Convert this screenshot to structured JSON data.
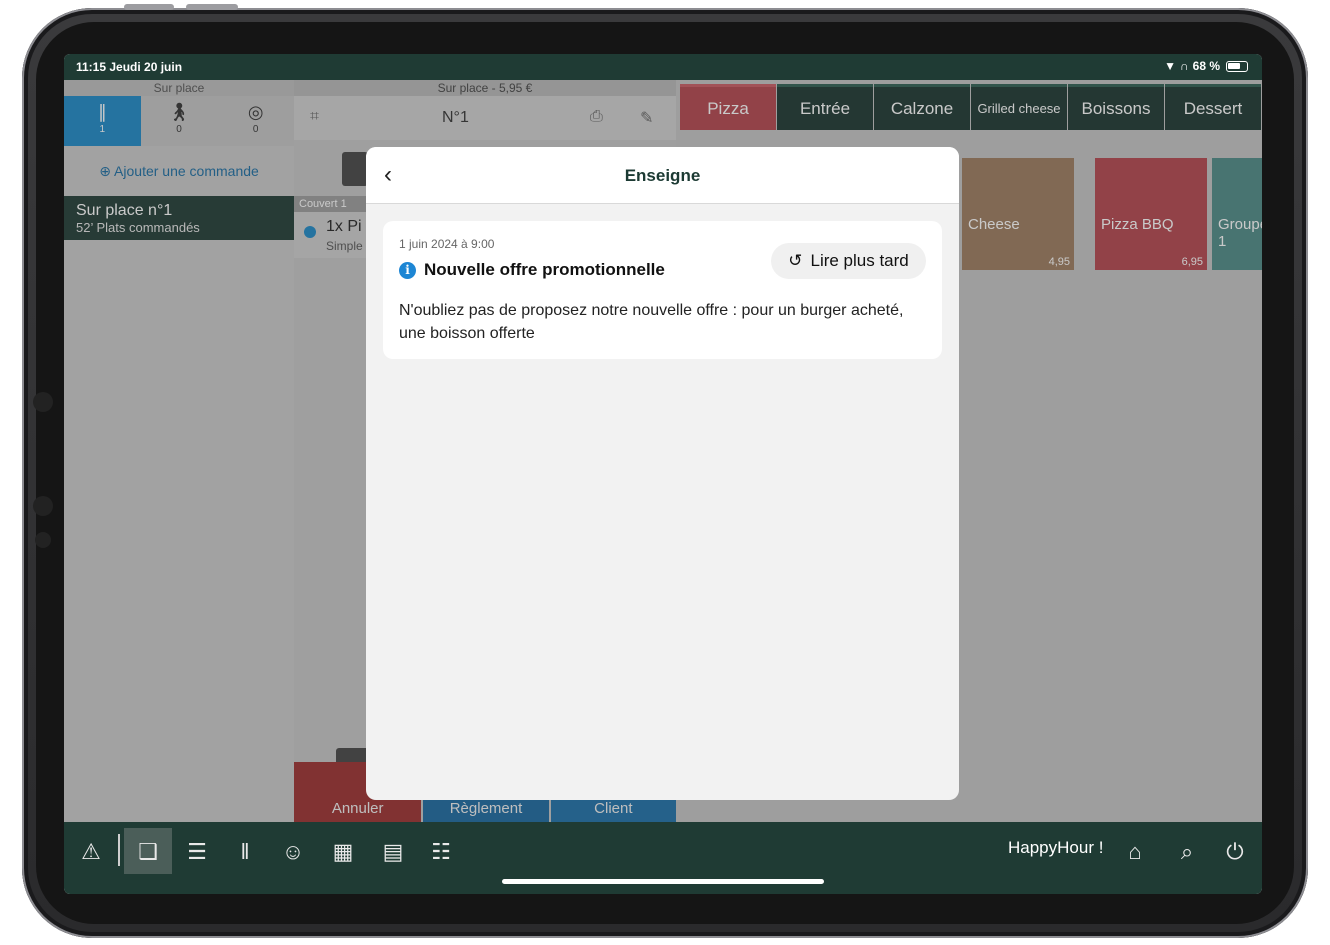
{
  "status_bar": {
    "time_date": "11:15  Jeudi 20 juin",
    "battery": "68 %"
  },
  "left_panel": {
    "header": "Sur place",
    "modes": [
      {
        "icon": "fork-knife-icon",
        "count": "1"
      },
      {
        "icon": "walking-person-icon",
        "count": "0"
      },
      {
        "icon": "location-pin-icon",
        "count": "0"
      }
    ],
    "add_order": "Ajouter une commande",
    "order": {
      "title": "Sur place n°1",
      "subtitle": "52’ Plats commandés"
    }
  },
  "middle_panel": {
    "header": "Sur place - 5,95 €",
    "number": "N°1",
    "cover_label": "Couvert 1",
    "item_name": "1x Pi",
    "item_sub": "Simple",
    "actions": {
      "cancel": "Annuler",
      "payment": "Règlement",
      "client": "Client"
    }
  },
  "categories": [
    "Pizza",
    "Entrée",
    "Calzone",
    "Grilled cheese",
    "Boissons",
    "Dessert"
  ],
  "products": [
    {
      "name": "Cheese",
      "price": "4,95",
      "color": "#7b5a44"
    },
    {
      "name": "Pizza BBQ",
      "price": "6,95",
      "color": "#b3454d"
    },
    {
      "name": "Groupe 1",
      "price": "",
      "color": "#4d8a86"
    }
  ],
  "dock": {
    "happy_hour": "HappyHour !"
  },
  "modal": {
    "title": "Enseigne",
    "message": {
      "date": "1 juin 2024 à 9:00",
      "title": "Nouvelle offre promotionnelle",
      "read_later": "Lire plus tard",
      "body": "N'oubliez pas de proposez notre nouvelle offre : pour un burger acheté, une boisson offerte"
    }
  },
  "colors": {
    "dark_green": "#1f3b34",
    "accent_blue": "#1c88c6",
    "pizza_red": "#b3454d"
  }
}
